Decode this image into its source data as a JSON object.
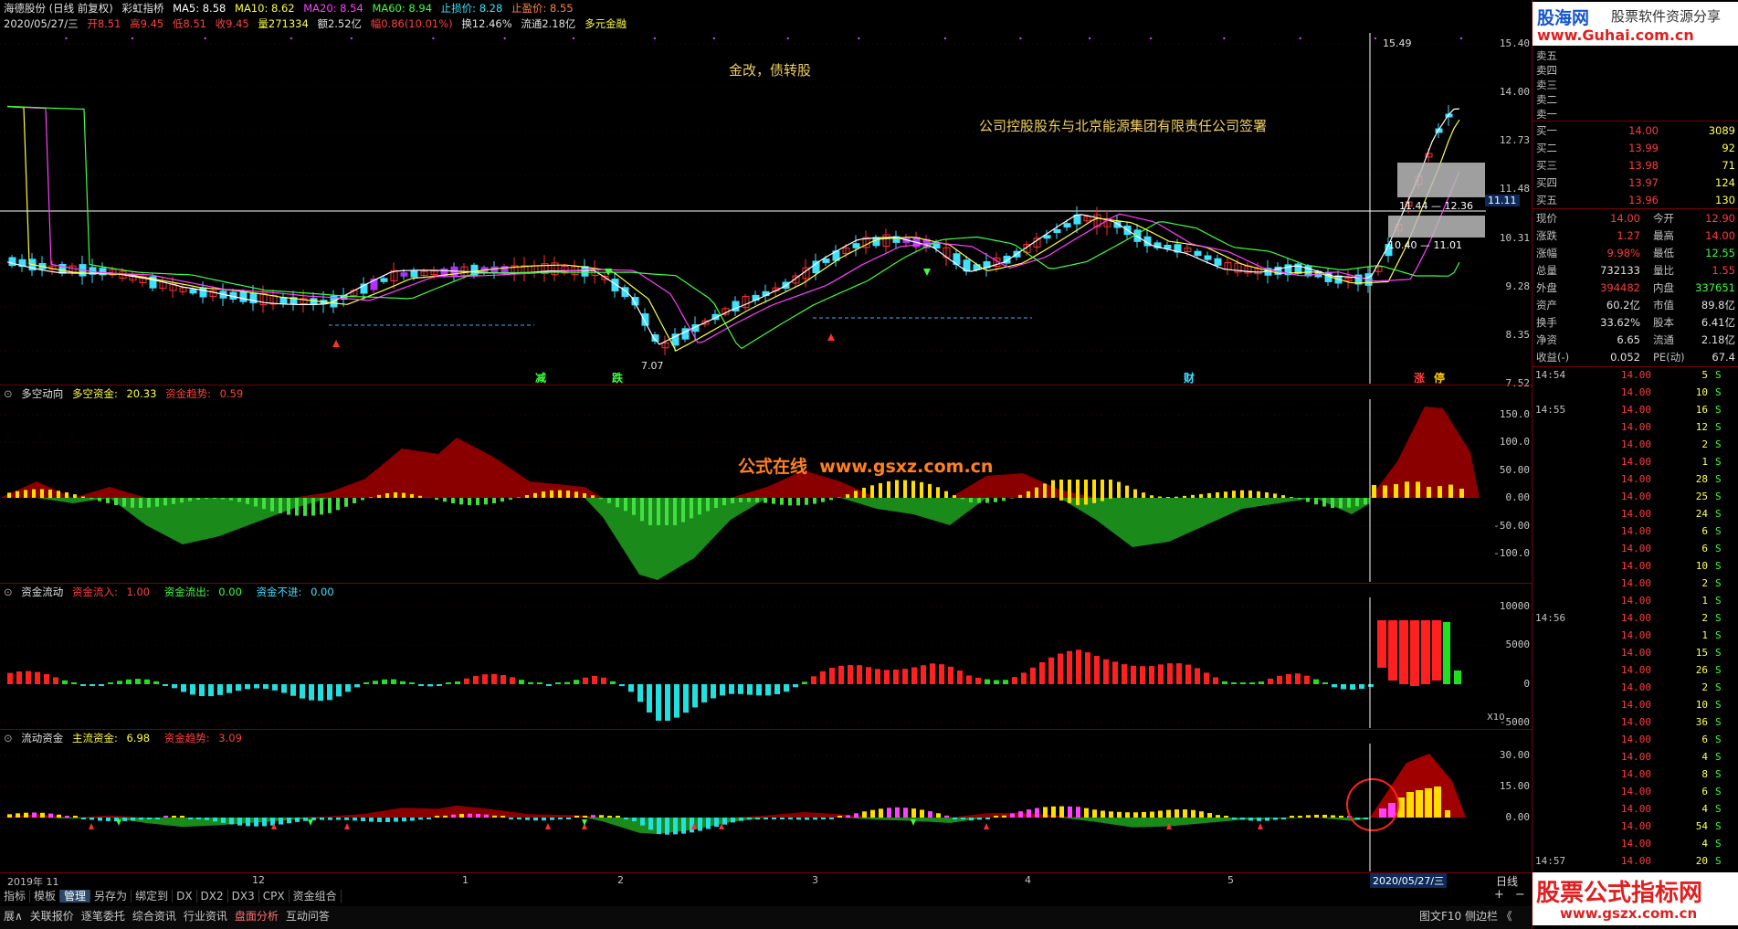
{
  "main_header": {
    "stock": "海德股份 (日线 前复权)",
    "indicator": "彩虹指桥",
    "ma5": "MA5: 8.58",
    "ma10": "MA10: 8.62",
    "ma20": "MA20: 8.54",
    "ma60": "MA60: 8.94",
    "stoploss": "止损价: 8.28",
    "takeprofit": "止盈价: 8.55",
    "date": "2020/05/27/三",
    "open": "开8.51",
    "high": "高9.45",
    "low": "低8.51",
    "close": "收9.45",
    "volume": "量271334",
    "amount": "额2.52亿",
    "amp": "幅0.86(10.01%)",
    "turnover": "换12.46%",
    "float": "流通2.18亿",
    "extra": "多元金融"
  },
  "annotations": {
    "news1": "金改，债转股",
    "news2": "公司控股股东与北京能源集团有限责任公司签署",
    "watermark": "公式在线  www.gsxz.com.cn",
    "tag_jian": "减",
    "tag_die": "跌",
    "tag_cai": "财",
    "tag_zhang": "涨",
    "tag_ting": "停",
    "high_label": "15.49",
    "low_label": "7.07",
    "box1": "11.44 — 12.36",
    "box2": "10.40 — 11.01",
    "crosshair_price": "11.11"
  },
  "main_axis": [
    "15.40",
    "14.00",
    "12.73",
    "11.48",
    "10.31",
    "9.28",
    "8.35",
    "7.52"
  ],
  "panel2": {
    "name": "多空动向",
    "k1": "多空资金:",
    "v1": "20.33",
    "k2": "资金趋势:",
    "v2": "0.59",
    "axis": [
      "150.0",
      "100.0",
      "50.00",
      "0.00",
      "-50.00",
      "-100.0"
    ]
  },
  "panel3": {
    "name": "资金流动",
    "k1": "资金流入:",
    "v1": "1.00",
    "k2": "资金流出:",
    "v2": "0.00",
    "k3": "资金不进:",
    "v3": "0.00",
    "axis": [
      "10000",
      "5000",
      "0",
      "-5000"
    ],
    "unit": "X10"
  },
  "panel4": {
    "name": "流动资金",
    "k1": "主流资金:",
    "v1": "6.98",
    "k2": "资金趋势:",
    "v2": "3.09",
    "axis": [
      "30.00",
      "15.00",
      "0.00"
    ]
  },
  "x_axis": [
    "2019年 11",
    "12",
    "1",
    "2",
    "3",
    "4",
    "5"
  ],
  "cursor_date": "2020/05/27/三",
  "period": "日线",
  "tabs": [
    "指标",
    "模板",
    "管理",
    "另存为",
    "绑定到",
    "DX",
    "DX2",
    "DX3",
    "CPX",
    "资金组合"
  ],
  "bottom_links": [
    "展∧",
    "关联报价",
    "逐笔委托",
    "综合资讯",
    "行业资讯",
    "盘面分析",
    "互动问答"
  ],
  "bottom_right": "图文F10 侧边栏 《",
  "logo_top": {
    "brand": "股海网",
    "slogan": "股票软件资源分享",
    "url": "www.Guhai.com.cn"
  },
  "logo_bottom": {
    "brand": "股票公式指标网",
    "url": "www.gszx.com.cn"
  },
  "order_book": {
    "asks": [
      {
        "label": "卖五"
      },
      {
        "label": "卖四"
      },
      {
        "label": "卖三"
      },
      {
        "label": "卖二"
      },
      {
        "label": "卖一"
      }
    ],
    "bids": [
      {
        "label": "买一",
        "price": "14.00",
        "vol": "3089"
      },
      {
        "label": "买二",
        "price": "13.99",
        "vol": "92"
      },
      {
        "label": "买三",
        "price": "13.98",
        "vol": "71"
      },
      {
        "label": "买四",
        "price": "13.97",
        "vol": "124"
      },
      {
        "label": "买五",
        "price": "13.96",
        "vol": "130"
      }
    ]
  },
  "quote": [
    {
      "k1": "现价",
      "v1": "14.00",
      "k2": "今开",
      "v2": "12.90"
    },
    {
      "k1": "涨跌",
      "v1": "1.27",
      "k2": "最高",
      "v2": "14.00"
    },
    {
      "k1": "涨幅",
      "v1": "9.98%",
      "k2": "最低",
      "v2": "12.55"
    },
    {
      "k1": "总量",
      "v1": "732133",
      "k2": "量比",
      "v2": "1.55"
    },
    {
      "k1": "外盘",
      "v1": "394482",
      "k2": "内盘",
      "v2": "337651"
    },
    {
      "k1": "资产",
      "v1": "60.2亿",
      "k2": "市值",
      "v2": "89.8亿"
    },
    {
      "k1": "换手",
      "v1": "33.62%",
      "k2": "股本",
      "v2": "6.41亿"
    },
    {
      "k1": "净资",
      "v1": "6.65",
      "k2": "流通",
      "v2": "2.18亿"
    },
    {
      "k1": "收益(-)",
      "v1": "0.052",
      "k2": "PE(动)",
      "v2": "67.4"
    }
  ],
  "ticks": [
    {
      "t": "14:54",
      "p": "14.00",
      "v": "5",
      "s": "S"
    },
    {
      "t": "",
      "p": "14.00",
      "v": "10",
      "s": "S"
    },
    {
      "t": "14:55",
      "p": "14.00",
      "v": "16",
      "s": "S"
    },
    {
      "t": "",
      "p": "14.00",
      "v": "12",
      "s": "S"
    },
    {
      "t": "",
      "p": "14.00",
      "v": "2",
      "s": "S"
    },
    {
      "t": "",
      "p": "14.00",
      "v": "1",
      "s": "S"
    },
    {
      "t": "",
      "p": "14.00",
      "v": "28",
      "s": "S"
    },
    {
      "t": "",
      "p": "14.00",
      "v": "25",
      "s": "S"
    },
    {
      "t": "",
      "p": "14.00",
      "v": "24",
      "s": "S"
    },
    {
      "t": "",
      "p": "14.00",
      "v": "6",
      "s": "S"
    },
    {
      "t": "",
      "p": "14.00",
      "v": "6",
      "s": "S"
    },
    {
      "t": "",
      "p": "14.00",
      "v": "10",
      "s": "S"
    },
    {
      "t": "",
      "p": "14.00",
      "v": "2",
      "s": "S"
    },
    {
      "t": "",
      "p": "14.00",
      "v": "1",
      "s": "S"
    },
    {
      "t": "14:56",
      "p": "14.00",
      "v": "2",
      "s": "S"
    },
    {
      "t": "",
      "p": "14.00",
      "v": "1",
      "s": "S"
    },
    {
      "t": "",
      "p": "14.00",
      "v": "15",
      "s": "S"
    },
    {
      "t": "",
      "p": "14.00",
      "v": "26",
      "s": "S"
    },
    {
      "t": "",
      "p": "14.00",
      "v": "2",
      "s": "S"
    },
    {
      "t": "",
      "p": "14.00",
      "v": "10",
      "s": "S"
    },
    {
      "t": "",
      "p": "14.00",
      "v": "36",
      "s": "S"
    },
    {
      "t": "",
      "p": "14.00",
      "v": "6",
      "s": "S"
    },
    {
      "t": "",
      "p": "14.00",
      "v": "4",
      "s": "S"
    },
    {
      "t": "",
      "p": "14.00",
      "v": "8",
      "s": "S"
    },
    {
      "t": "",
      "p": "14.00",
      "v": "6",
      "s": "S"
    },
    {
      "t": "",
      "p": "14.00",
      "v": "4",
      "s": "S"
    },
    {
      "t": "",
      "p": "14.00",
      "v": "54",
      "s": "S"
    },
    {
      "t": "",
      "p": "14.00",
      "v": "4",
      "s": "S"
    },
    {
      "t": "14:57",
      "p": "14.00",
      "v": "20",
      "s": "S"
    }
  ]
}
